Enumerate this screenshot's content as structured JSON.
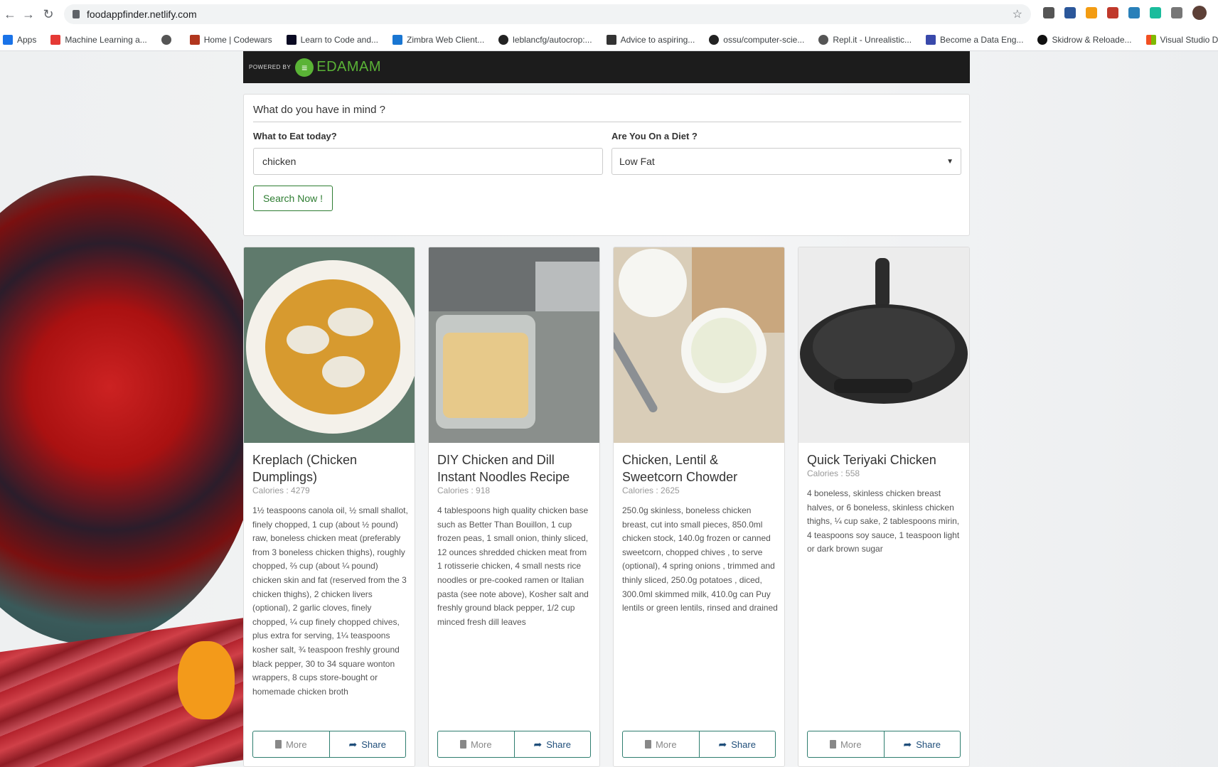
{
  "browser": {
    "url": "foodappfinder.netlify.com",
    "bookmarks": [
      "Apps",
      "Machine Learning a...",
      "",
      "Home | Codewars",
      "Learn to Code and...",
      "Zimbra Web Client...",
      "leblancfg/autocrop:...",
      "Advice to aspiring...",
      "ossu/computer-scie...",
      "Repl.it - Unrealistic...",
      "Become a Data Eng...",
      "Skidrow & Reloade...",
      "Visual Studio Dev E..."
    ]
  },
  "header": {
    "powered_by": "POWERED BY",
    "brand": "EDAMAM"
  },
  "search": {
    "title": "What do you have in mind ?",
    "food_label": "What to Eat today?",
    "food_value": "chicken",
    "diet_label": "Are You On a Diet ?",
    "diet_value": "Low Fat",
    "button": "Search Now !"
  },
  "cards": [
    {
      "title": "Kreplach (Chicken Dumplings)",
      "calories": "Calories : 4279",
      "ingredients": "1½ teaspoons canola oil, ½ small shallot, finely chopped, 1 cup (about ½ pound) raw, boneless chicken meat (preferably from 3 boneless chicken thighs), roughly chopped, ⅔ cup (about ¼ pound) chicken skin and fat (reserved from the 3 chicken thighs), 2 chicken livers (optional), 2 garlic cloves, finely chopped, ¼ cup finely chopped chives, plus extra for serving, 1¼ teaspoons kosher salt, ¾ teaspoon freshly ground black pepper, 30 to 34 square wonton wrappers, 8 cups store-bought or homemade chicken broth",
      "more": "More",
      "share": "Share"
    },
    {
      "title": "DIY Chicken and Dill Instant Noodles Recipe",
      "calories": "Calories : 918",
      "ingredients": "4 tablespoons high quality chicken base such as Better Than Bouillon, 1 cup frozen peas, 1 small onion, thinly sliced, 12 ounces shredded chicken meat from 1 rotisserie chicken, 4 small nests rice noodles or pre-cooked ramen or Italian pasta (see note above), Kosher salt and freshly ground black pepper, 1/2 cup minced fresh dill leaves",
      "more": "More",
      "share": "Share"
    },
    {
      "title": "Chicken, Lentil & Sweetcorn Chowder",
      "calories": "Calories : 2625",
      "ingredients": "250.0g skinless, boneless chicken breast, cut into small pieces, 850.0ml chicken stock, 140.0g frozen or canned sweetcorn, chopped chives , to serve (optional), 4 spring onions , trimmed and thinly sliced, 250.0g potatoes , diced, 300.0ml skimmed milk, 410.0g can Puy lentils or green lentils, rinsed and drained",
      "more": "More",
      "share": "Share"
    },
    {
      "title": "Quick Teriyaki Chicken",
      "calories": "Calories : 558",
      "ingredients": "4 boneless, skinless chicken breast halves, or 6 boneless, skinless chicken thighs, ¼ cup sake, 2 tablespoons mirin, 4 teaspoons soy sauce, 1 teaspoon light or dark brown sugar",
      "more": "More",
      "share": "Share"
    }
  ],
  "colors": {
    "brand_green": "#5ab336",
    "button_green": "#2e7d32",
    "header_bg": "#1c1c1c"
  }
}
